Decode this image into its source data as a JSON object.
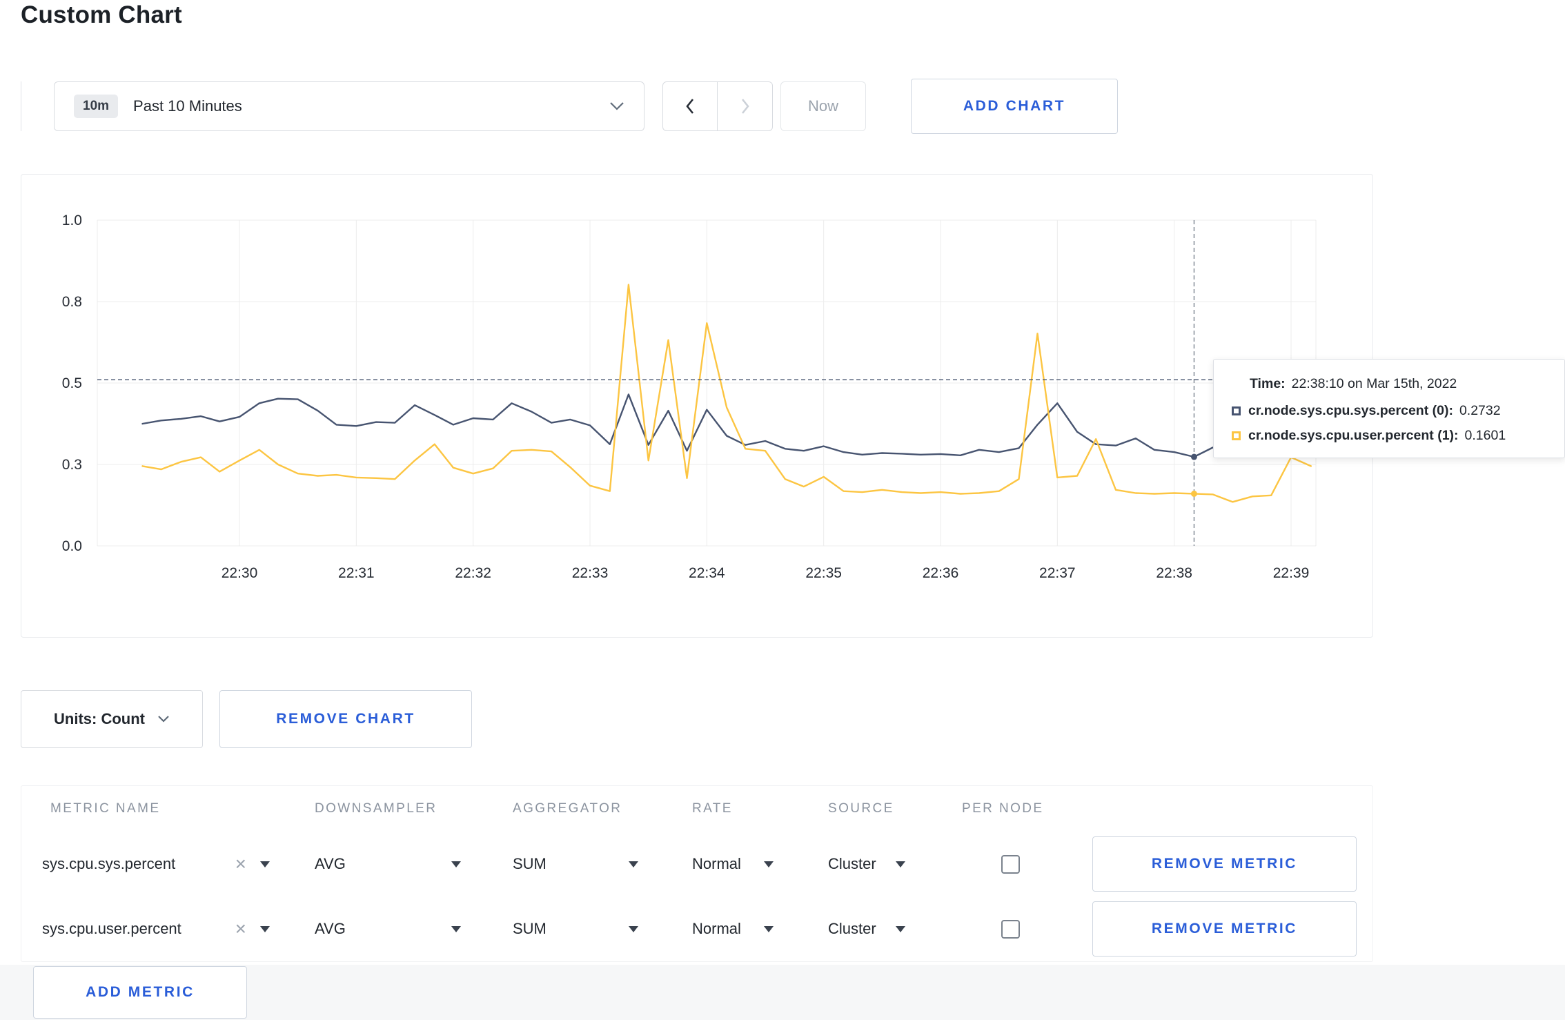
{
  "page": {
    "title": "Custom Chart"
  },
  "colors": {
    "accent_blue": "#2a5dd8"
  },
  "toolbar": {
    "time_range": {
      "badge": "10m",
      "label": "Past 10 Minutes"
    },
    "now_label": "Now",
    "add_chart_label": "ADD CHART"
  },
  "tooltip": {
    "time_label": "Time:",
    "time_value": "22:38:10 on Mar 15th, 2022",
    "rows": [
      {
        "name": "cr.node.sys.cpu.sys.percent (0):",
        "value": "0.2732"
      },
      {
        "name": "cr.node.sys.cpu.user.percent (1):",
        "value": "0.1601"
      }
    ]
  },
  "units": {
    "label": "Units: Count",
    "remove_chart_label": "REMOVE CHART"
  },
  "metrics_table": {
    "headers": [
      "METRIC NAME",
      "DOWNSAMPLER",
      "AGGREGATOR",
      "RATE",
      "SOURCE",
      "PER NODE"
    ],
    "remove_metric_label": "REMOVE METRIC",
    "add_metric_label": "ADD METRIC",
    "rows": [
      {
        "metric": "sys.cpu.sys.percent",
        "downsampler": "AVG",
        "aggregator": "SUM",
        "rate": "Normal",
        "source": "Cluster",
        "per_node_checked": false
      },
      {
        "metric": "sys.cpu.user.percent",
        "downsampler": "AVG",
        "aggregator": "SUM",
        "rate": "Normal",
        "source": "Cluster",
        "per_node_checked": false
      }
    ]
  },
  "chart_data": {
    "type": "line",
    "title": "",
    "xlabel": "",
    "ylabel": "",
    "grid": true,
    "legend_position": "tooltip",
    "x_axis": {
      "domain": [
        30,
        39
      ],
      "ticks": [
        30,
        31,
        32,
        33,
        34,
        35,
        36,
        37,
        38,
        39
      ],
      "tick_labels": [
        "22:30",
        "22:31",
        "22:32",
        "22:33",
        "22:34",
        "22:35",
        "22:36",
        "22:37",
        "22:38",
        "22:39"
      ]
    },
    "y_axis": {
      "ylim": [
        0,
        1
      ],
      "tick_values": [
        0,
        0.25,
        0.5,
        0.75,
        1
      ],
      "tick_labels": [
        "0.0",
        "0.3",
        "0.5",
        "0.8",
        "1.0"
      ]
    },
    "x_unit": "minutes after 22:00 on Mar 15th, 2022",
    "x": [
      29.17,
      29.33,
      29.5,
      29.67,
      29.83,
      30,
      30.17,
      30.33,
      30.5,
      30.67,
      30.83,
      31,
      31.17,
      31.33,
      31.5,
      31.67,
      31.83,
      32,
      32.17,
      32.33,
      32.5,
      32.67,
      32.83,
      33,
      33.17,
      33.33,
      33.5,
      33.67,
      33.83,
      34,
      34.17,
      34.33,
      34.5,
      34.67,
      34.83,
      35,
      35.17,
      35.33,
      35.5,
      35.67,
      35.83,
      36,
      36.17,
      36.33,
      36.5,
      36.67,
      36.83,
      37,
      37.17,
      37.33,
      37.5,
      37.67,
      37.83,
      38,
      38.17,
      38.33,
      38.5,
      38.67,
      38.83,
      39,
      39.17
    ],
    "series": [
      {
        "name": "cr.node.sys.cpu.sys.percent",
        "color": "#475470",
        "values": [
          0.375,
          0.385,
          0.39,
          0.398,
          0.382,
          0.396,
          0.438,
          0.452,
          0.45,
          0.415,
          0.372,
          0.368,
          0.38,
          0.378,
          0.432,
          0.402,
          0.372,
          0.392,
          0.388,
          0.438,
          0.412,
          0.378,
          0.388,
          0.37,
          0.312,
          0.465,
          0.31,
          0.415,
          0.292,
          0.418,
          0.338,
          0.31,
          0.322,
          0.298,
          0.292,
          0.306,
          0.288,
          0.28,
          0.285,
          0.283,
          0.28,
          0.282,
          0.278,
          0.295,
          0.288,
          0.3,
          0.372,
          0.438,
          0.35,
          0.312,
          0.308,
          0.33,
          0.295,
          0.288,
          0.2732,
          0.302,
          0.318,
          0.298,
          0.3,
          0.305,
          0.308
        ]
      },
      {
        "name": "cr.node.sys.cpu.user.percent",
        "color": "#fcc542",
        "values": [
          0.245,
          0.235,
          0.258,
          0.272,
          0.228,
          0.262,
          0.295,
          0.25,
          0.222,
          0.215,
          0.218,
          0.21,
          0.208,
          0.205,
          0.262,
          0.312,
          0.24,
          0.222,
          0.238,
          0.292,
          0.295,
          0.29,
          0.242,
          0.185,
          0.168,
          0.802,
          0.262,
          0.632,
          0.208,
          0.684,
          0.425,
          0.298,
          0.292,
          0.205,
          0.182,
          0.212,
          0.168,
          0.165,
          0.172,
          0.165,
          0.162,
          0.165,
          0.16,
          0.162,
          0.168,
          0.205,
          0.652,
          0.21,
          0.215,
          0.328,
          0.172,
          0.162,
          0.16,
          0.162,
          0.1601,
          0.158,
          0.135,
          0.152,
          0.155,
          0.272,
          0.245
        ]
      }
    ],
    "crosshair": {
      "x": 38.17,
      "hline": 0.51,
      "points": [
        0.2732,
        0.1601
      ]
    }
  }
}
